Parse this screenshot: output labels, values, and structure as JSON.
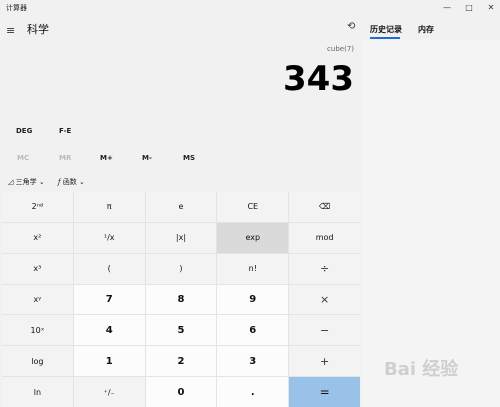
{
  "window": {
    "title": "计算器",
    "minimize": "—",
    "maximize": "□",
    "close": "✕"
  },
  "header": {
    "mode_title": "科学",
    "history_tab": "历史记录",
    "memory_tab": "内存"
  },
  "display": {
    "expression": "cube(7)",
    "result": "343"
  },
  "modes": {
    "deg": "DEG",
    "fe": "F-E"
  },
  "memory": [
    "MC",
    "MR",
    "M+",
    "M-",
    "MS"
  ],
  "functions": {
    "trig": "三角学",
    "func": "函数"
  },
  "keys": [
    [
      "2ⁿᵈ",
      "π",
      "e",
      "CE",
      "⌫"
    ],
    [
      "x²",
      "¹/x",
      "|x|",
      "exp",
      "mod"
    ],
    [
      "x³",
      "(",
      ")",
      "n!",
      "÷"
    ],
    [
      "xʸ",
      "7",
      "8",
      "9",
      "×"
    ],
    [
      "10ˣ",
      "4",
      "5",
      "6",
      "−"
    ],
    [
      "log",
      "1",
      "2",
      "3",
      "+"
    ],
    [
      "ln",
      "⁺/₋",
      "0",
      ".",
      "="
    ]
  ],
  "watermark": "Bai 经验"
}
